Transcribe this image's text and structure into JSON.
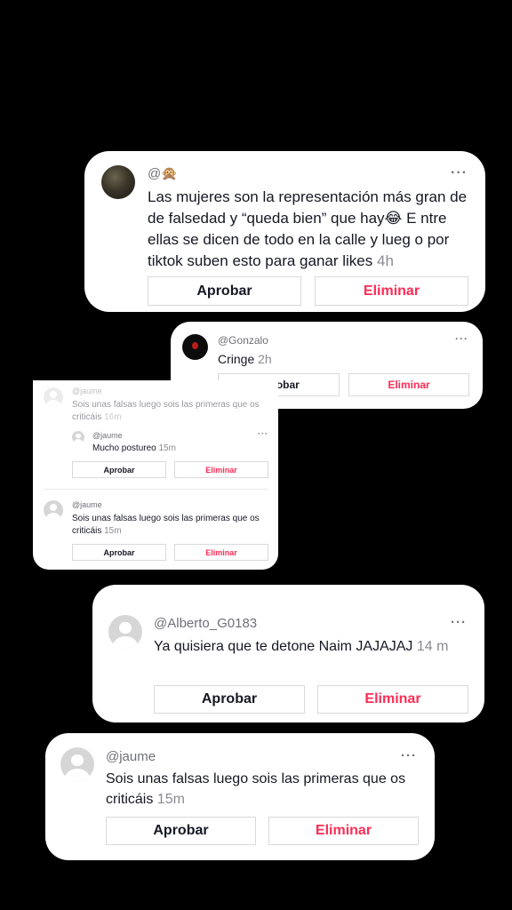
{
  "buttons": {
    "approve": "Aprobar",
    "delete": "Eliminar"
  },
  "more_icon": "···",
  "comments": [
    {
      "username": "@🙊",
      "text": "Las mujeres son la representación más gran de de falsedad y “queda bien” que hay😂 E ntre ellas se dicen de todo en la calle y lueg o por tiktok suben esto para ganar likes",
      "time": "4h",
      "avatar": "photo-avatar"
    },
    {
      "username": "@Gonzalo",
      "text": "Cringe",
      "time": "2h",
      "avatar": "dark-avatar"
    },
    {
      "thread": [
        {
          "username": "@jaume",
          "text": "Sois unas falsas luego sois las primeras que os criticáis",
          "time": "16m"
        },
        {
          "username": "@jaume",
          "text": "Mucho postureo",
          "time": "15m"
        },
        {
          "username": "@jaume",
          "text": "Sois unas falsas luego sois las primeras que os criticáis",
          "time": "15m"
        }
      ]
    },
    {
      "username": "@Alberto_G0183",
      "text": "Ya quisiera que te detone Naim JAJAJAJ",
      "time": "14 m",
      "avatar": "default-avatar"
    },
    {
      "username": "@jaume",
      "text": "Sois unas falsas luego sois las primeras que os criticáis",
      "time": "15m",
      "avatar": "default-avatar"
    }
  ]
}
